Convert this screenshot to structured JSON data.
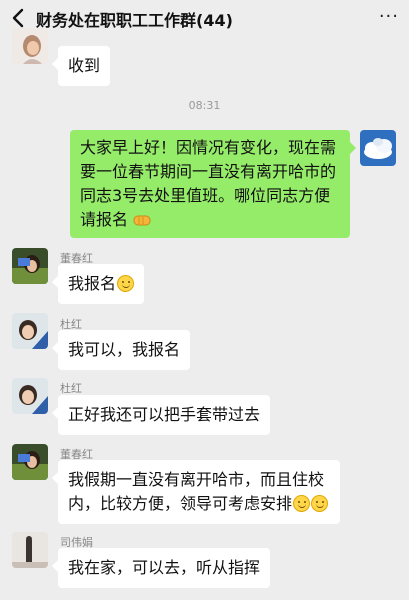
{
  "header": {
    "title": "财务处在职职工工作群(44)",
    "more_label": "···"
  },
  "messages": {
    "m0": {
      "text": "收到"
    },
    "time": "08:31",
    "m1": {
      "text": "大家早上好！因情况有变化，现在需要一位春节期间一直没有离开哈市的同志3号去处里值班。哪位同志方便请报名"
    },
    "m2": {
      "sender": "董春红",
      "text": "我报名"
    },
    "m3": {
      "sender": "杜红",
      "text": "我可以，我报名"
    },
    "m4": {
      "sender": "杜红",
      "text": "正好我还可以把手套带过去"
    },
    "m5": {
      "sender": "董春红",
      "text": "我假期一直没有离开哈市，而且住校内，比较方便，领导可考虑安排"
    },
    "m6": {
      "sender": "司伟娟",
      "text": "我在家，可以去，听从指挥"
    }
  },
  "colors": {
    "background": "#ededed",
    "bubble_mine": "#95ec69",
    "bubble_other": "#ffffff"
  }
}
